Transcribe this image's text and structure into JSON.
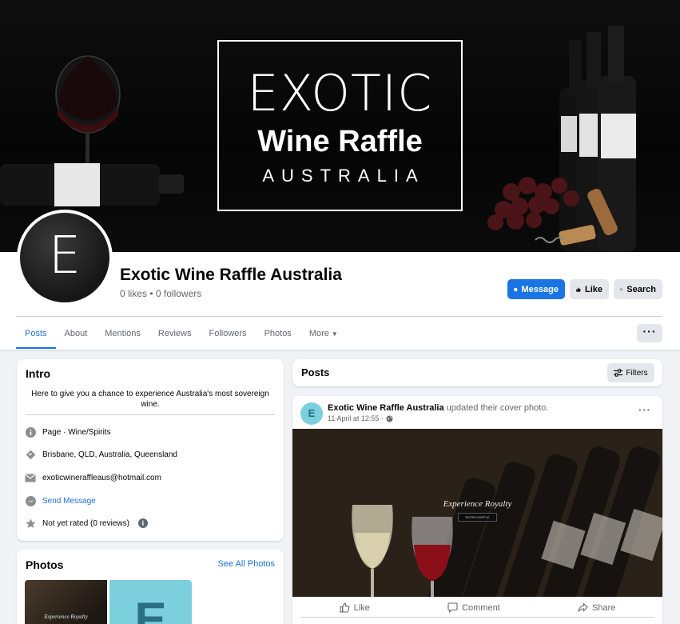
{
  "cover": {
    "logo_line1": "EXOTIC",
    "logo_line2": "Wine Raffle",
    "logo_line3": "AUSTRALIA"
  },
  "avatar": {
    "letter": "E"
  },
  "header": {
    "page_name": "Exotic Wine Raffle Australia",
    "stats": "0 likes • 0 followers",
    "message_label": "Message",
    "like_label": "Like",
    "search_label": "Search",
    "more_menu_label": "···"
  },
  "tabs": [
    {
      "label": "Posts",
      "active": true
    },
    {
      "label": "About"
    },
    {
      "label": "Mentions"
    },
    {
      "label": "Reviews"
    },
    {
      "label": "Followers"
    },
    {
      "label": "Photos"
    },
    {
      "label": "More"
    }
  ],
  "intro": {
    "title": "Intro",
    "bio": "Here to give you a chance to experience Australia's most sovereign wine.",
    "category": "Page · Wine/Spirits",
    "location": "Brisbane, QLD, Australia, Queensland",
    "email": "exoticwineraffleaus@hotmail.com",
    "send_message": "Send Message",
    "rating": "Not yet rated (0 reviews)"
  },
  "photos": {
    "title": "Photos",
    "see_all": "See All Photos",
    "thumb1_text": "Experience Royalty",
    "thumb2_letter": "E"
  },
  "posts": {
    "title": "Posts",
    "filters_label": "Filters"
  },
  "post": {
    "avatar_letter": "E",
    "author": "Exotic Wine Raffle Australia",
    "action": " updated their cover photo.",
    "timestamp": "11 April at 12:55 ·",
    "image_text": "Experience Royalty",
    "image_button": "ENTER RAFFLE",
    "like_label": "Like",
    "comment_label": "Comment",
    "share_label": "Share"
  },
  "colors": {
    "brand_blue": "#1b74e4",
    "link_blue": "#216fdb",
    "page_bg": "#f0f2f5",
    "avatar_teal": "#7ccfdc"
  }
}
